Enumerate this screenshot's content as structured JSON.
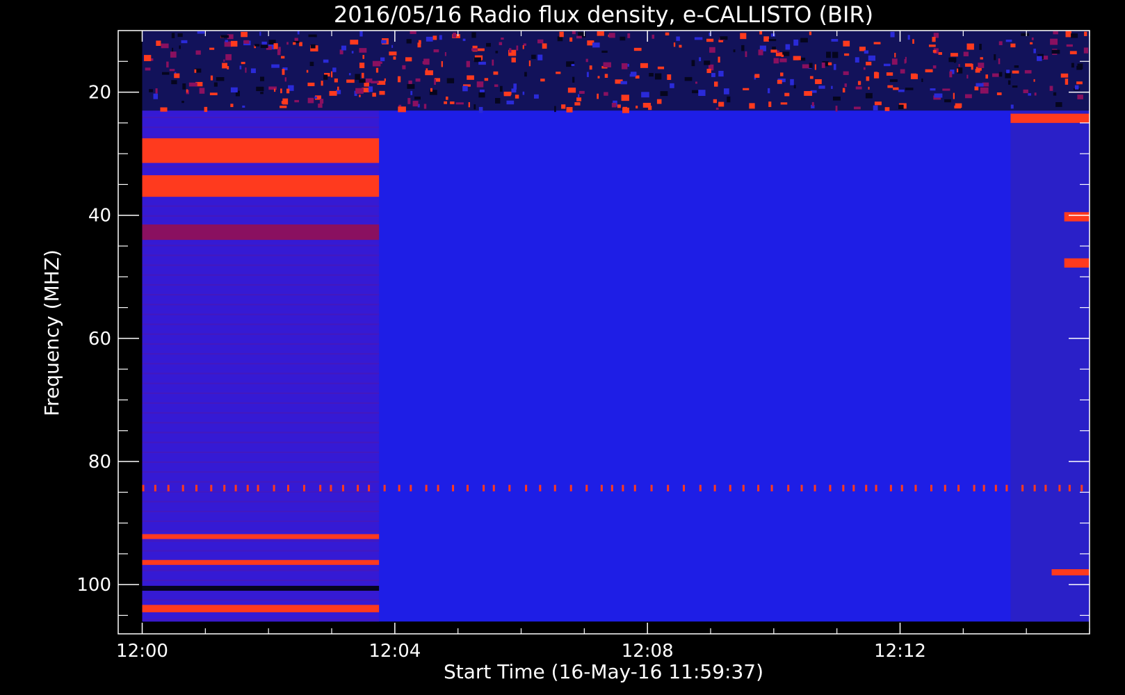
{
  "chart_data": {
    "type": "heatmap",
    "title": "2016/05/16  Radio flux density, e-CALLISTO (BIR)",
    "xlabel": "Start Time (16-May-16 11:59:37)",
    "ylabel": "Frequency (MHZ)",
    "x_range_minutes": [
      -0.38,
      15.0
    ],
    "ylim": [
      108,
      10
    ],
    "y_inverted": true,
    "data_x_extent_minutes": [
      0.0,
      15.0
    ],
    "data_y_extent_mhz": [
      10,
      106
    ],
    "x_ticks": [
      {
        "value": 0,
        "label": "12:00"
      },
      {
        "value": 4,
        "label": "12:04"
      },
      {
        "value": 8,
        "label": "12:08"
      },
      {
        "value": 12,
        "label": "12:12"
      }
    ],
    "x_minor_ticks": [
      1,
      2,
      3,
      5,
      6,
      7,
      9,
      10,
      11,
      13,
      14,
      15
    ],
    "y_ticks": [
      {
        "value": 20,
        "label": "20"
      },
      {
        "value": 40,
        "label": "40"
      },
      {
        "value": 60,
        "label": "60"
      },
      {
        "value": 80,
        "label": "80"
      },
      {
        "value": 100,
        "label": "100"
      }
    ],
    "y_minor_ticks": [
      15,
      25,
      30,
      35,
      45,
      50,
      55,
      65,
      70,
      75,
      85,
      90,
      95,
      105
    ],
    "colors": {
      "background": "#000000",
      "base": "#1e1ee6",
      "early_segment": "#3a1ad0",
      "hot": "#ff3a1e",
      "warm": "#8a1060",
      "dark": "#05051e",
      "axis": "#ffffff"
    },
    "segment_break_minutes": 3.75,
    "late_segment_start_minutes": 13.75,
    "features": [
      {
        "t0": 0.0,
        "t1": 15.0,
        "f0": 10,
        "f1": 23,
        "kind": "rfi-noise"
      },
      {
        "t0": 0.0,
        "t1": 3.75,
        "f0": 27.5,
        "f1": 31.5,
        "kind": "hot"
      },
      {
        "t0": 0.0,
        "t1": 3.75,
        "f0": 33.5,
        "f1": 37.0,
        "kind": "hot"
      },
      {
        "t0": 0.0,
        "t1": 3.75,
        "f0": 41.5,
        "f1": 44.0,
        "kind": "warm"
      },
      {
        "t0": 0.0,
        "t1": 15.0,
        "f0": 83.8,
        "f1": 84.4,
        "kind": "dashed"
      },
      {
        "t0": 0.0,
        "t1": 3.75,
        "f0": 91.8,
        "f1": 92.6,
        "kind": "hot"
      },
      {
        "t0": 0.0,
        "t1": 3.75,
        "f0": 96.0,
        "f1": 96.8,
        "kind": "hot"
      },
      {
        "t0": 0.0,
        "t1": 3.75,
        "f0": 100.2,
        "f1": 101.0,
        "kind": "dark"
      },
      {
        "t0": 0.0,
        "t1": 3.75,
        "f0": 103.3,
        "f1": 104.5,
        "kind": "hot"
      },
      {
        "t0": 13.75,
        "t1": 15.0,
        "f0": 23.5,
        "f1": 25.0,
        "kind": "hot"
      },
      {
        "t0": 14.6,
        "t1": 15.0,
        "f0": 39.5,
        "f1": 41.0,
        "kind": "hot"
      },
      {
        "t0": 14.6,
        "t1": 15.0,
        "f0": 47.0,
        "f1": 48.5,
        "kind": "hot"
      },
      {
        "t0": 14.4,
        "t1": 15.0,
        "f0": 97.5,
        "f1": 98.5,
        "kind": "hot"
      }
    ]
  }
}
